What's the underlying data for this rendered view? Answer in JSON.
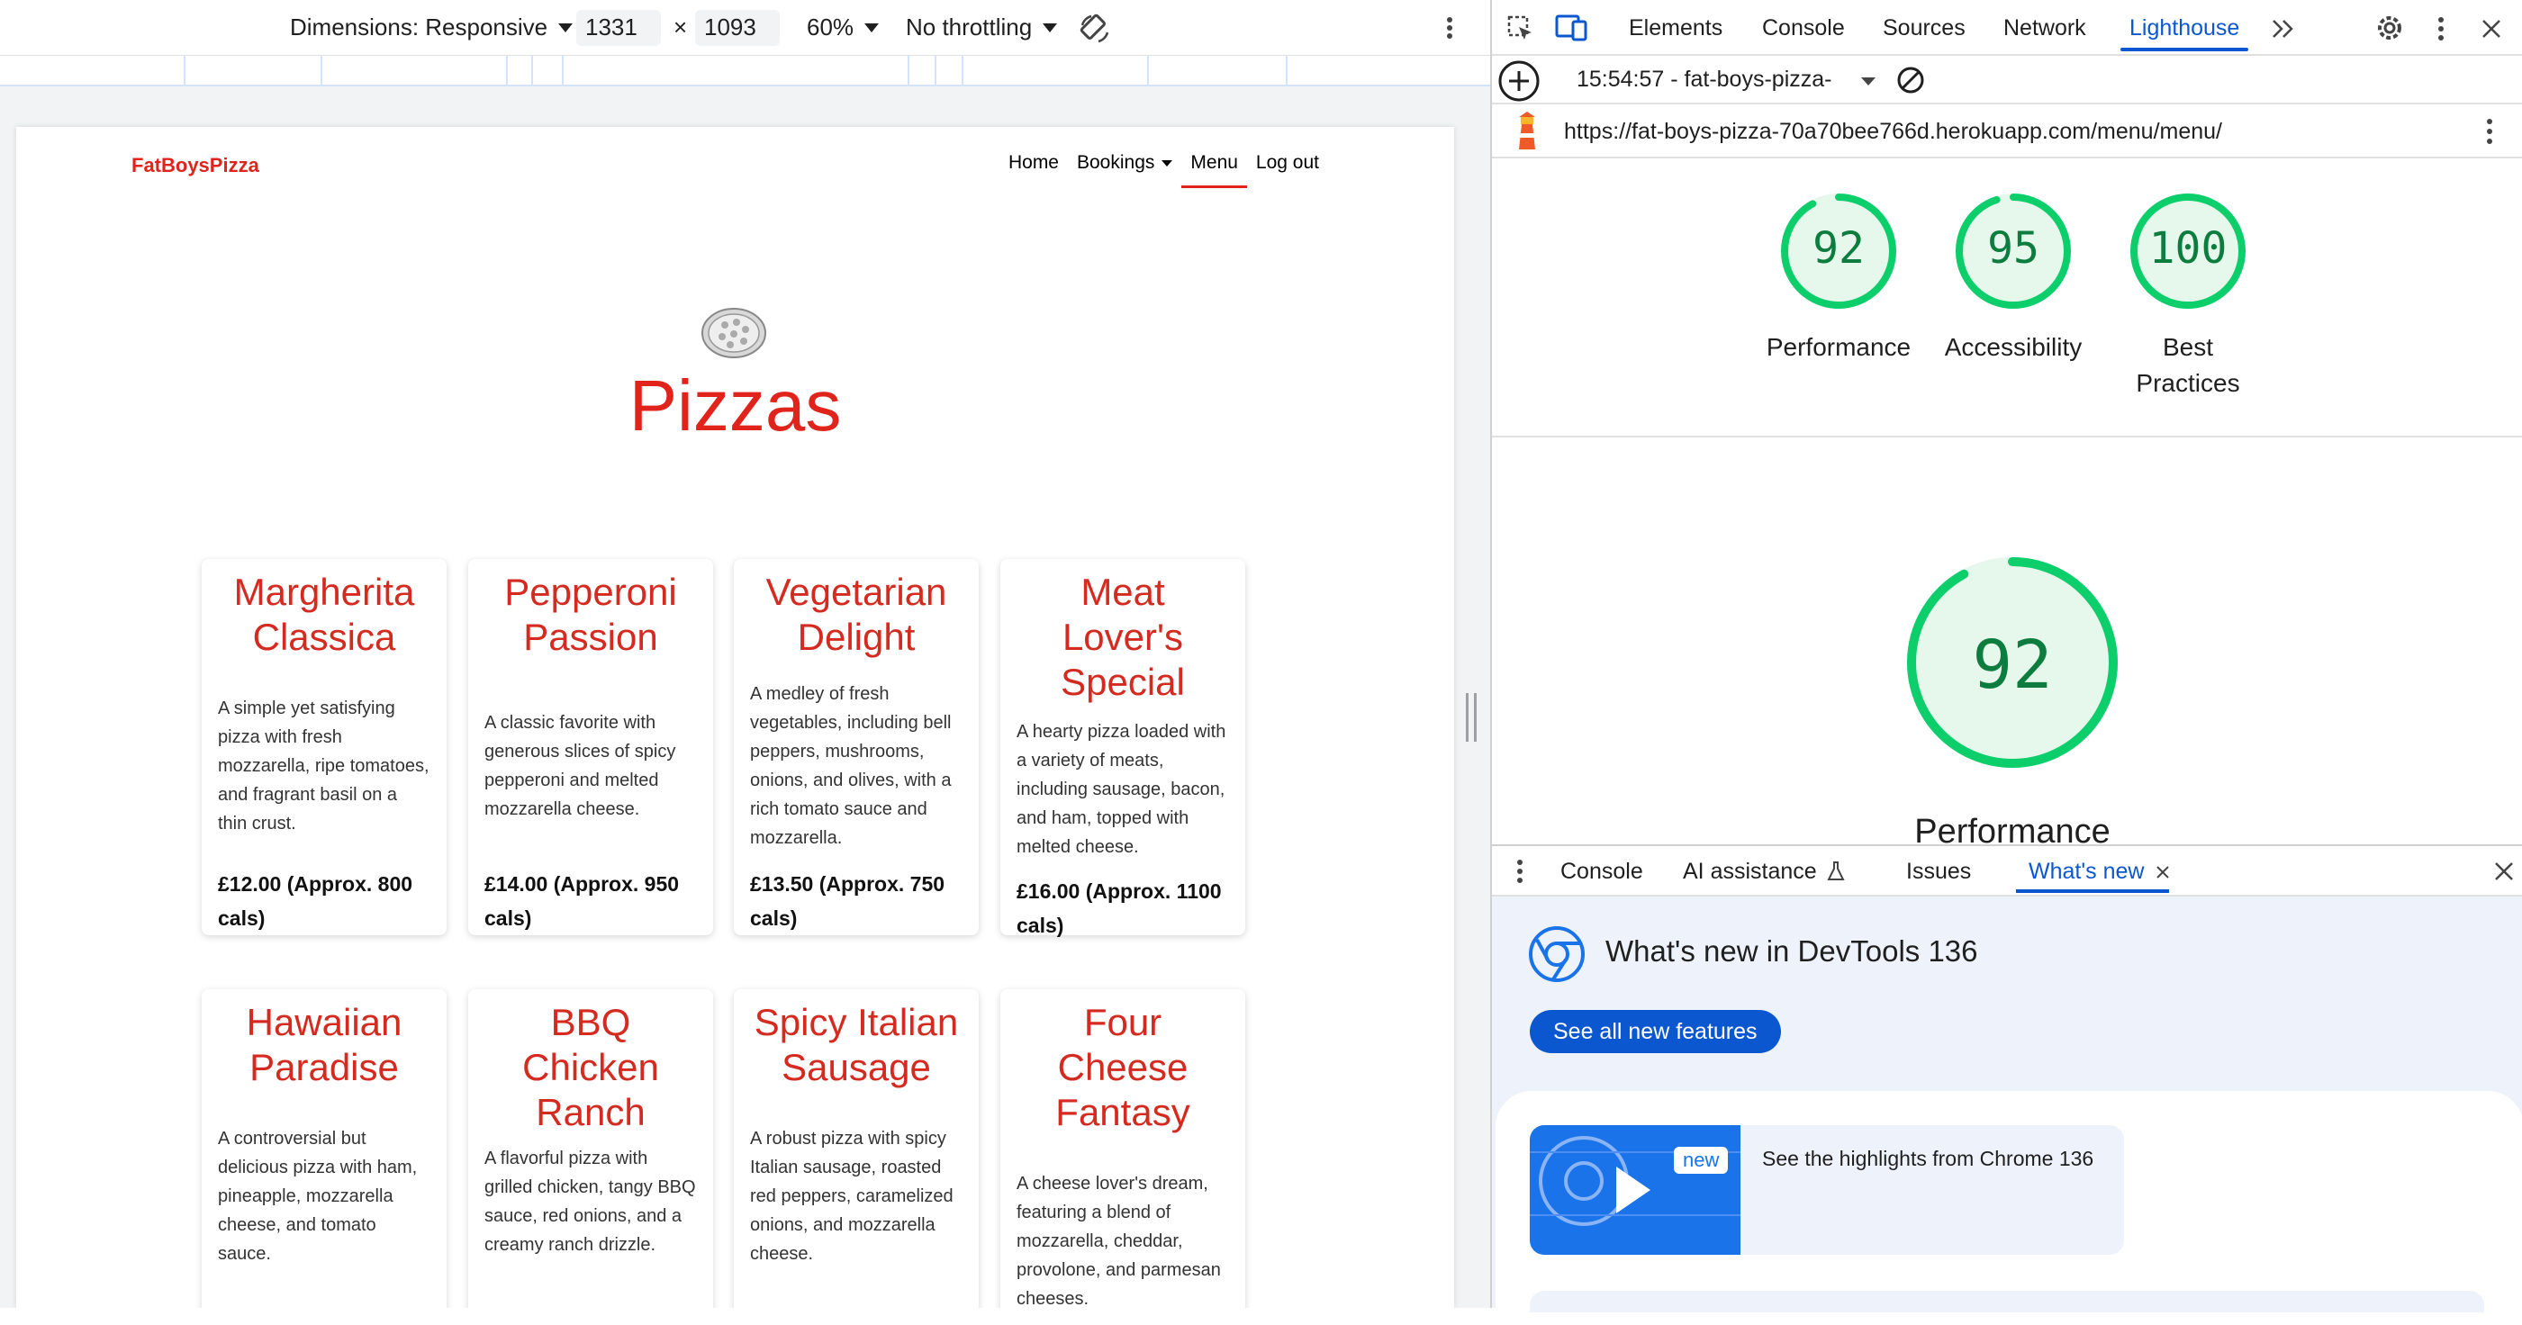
{
  "device_toolbar": {
    "dimensions_label": "Dimensions: Responsive",
    "width": "1331",
    "times": "×",
    "height": "1093",
    "zoom": "60%",
    "throttling": "No throttling"
  },
  "site": {
    "brand": "FatBoysPizza",
    "nav": [
      "Home",
      "Bookings",
      "Menu",
      "Log out"
    ],
    "active_nav": "Menu",
    "title": "Pizzas",
    "cards": [
      {
        "name": "Margherita Classica",
        "desc": "A simple yet satisfying pizza with fresh mozzarella, ripe tomatoes, and fragrant basil on a thin crust.",
        "price": "£12.00 (Approx. 800 cals)"
      },
      {
        "name": "Pepperoni Passion",
        "desc": "A classic favorite with generous slices of spicy pepperoni and melted mozzarella cheese.",
        "price": "£14.00 (Approx. 950 cals)"
      },
      {
        "name": "Vegetarian Delight",
        "desc": "A medley of fresh vegetables, including bell peppers, mushrooms, onions, and olives, with a rich tomato sauce and mozzarella.",
        "price": "£13.50 (Approx. 750 cals)"
      },
      {
        "name": "Meat Lover's Special",
        "desc": "A hearty pizza loaded with a variety of meats, including sausage, bacon, and ham, topped with melted cheese.",
        "price": "£16.00 (Approx. 1100 cals)"
      },
      {
        "name": "Hawaiian Paradise",
        "desc": "A controversial but delicious pizza with ham, pineapple, mozzarella cheese, and tomato sauce.",
        "price": ""
      },
      {
        "name": "BBQ Chicken Ranch",
        "desc": "A flavorful pizza with grilled chicken, tangy BBQ sauce, red onions, and a creamy ranch drizzle.",
        "price": ""
      },
      {
        "name": "Spicy Italian Sausage",
        "desc": "A robust pizza with spicy Italian sausage, roasted red peppers, caramelized onions, and mozzarella cheese.",
        "price": ""
      },
      {
        "name": "Four Cheese Fantasy",
        "desc": "A cheese lover's dream, featuring a blend of mozzarella, cheddar, provolone, and parmesan cheeses.",
        "price": ""
      }
    ],
    "accent_color": "#e0241b"
  },
  "devtools": {
    "tabs": [
      "Elements",
      "Console",
      "Sources",
      "Network",
      "Lighthouse"
    ],
    "selected_tab": "Lighthouse",
    "report_label": "15:54:57 - fat-boys-pizza-",
    "url": "https://fat-boys-pizza-70a70bee766d.herokuapp.com/menu/menu/",
    "scores": [
      {
        "value": "92",
        "label": "Performance"
      },
      {
        "value": "95",
        "label": "Accessibility"
      },
      {
        "value": "100",
        "label": "Best Practices"
      }
    ],
    "big_score": {
      "value": "92",
      "label": "Performance"
    },
    "score_color": "#0cce6b",
    "drawer_tabs": [
      "Console",
      "AI assistance",
      "Issues",
      "What's new"
    ],
    "whats_new_title": "What's new in DevTools 136",
    "see_all_button": "See all new features",
    "highlight_badge": "new",
    "highlight_text": "See the highlights from Chrome 136"
  }
}
